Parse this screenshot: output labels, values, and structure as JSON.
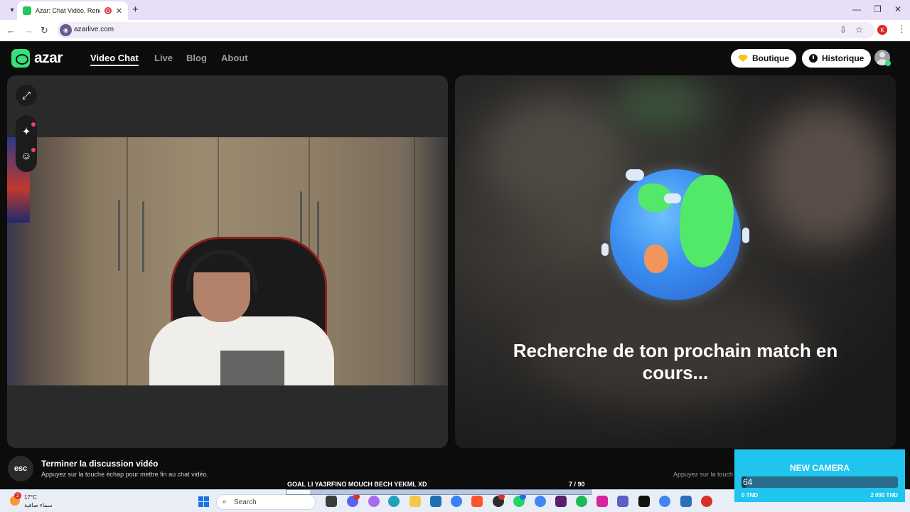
{
  "browser": {
    "tab_title": "Azar: Chat Vidéo, Rencontr",
    "url": "azarlive.com",
    "profile_initial": "K",
    "new_tab_symbol": "+",
    "close_symbol": "✕"
  },
  "header": {
    "logo_text": "azar",
    "nav": [
      "Video Chat",
      "Live",
      "Blog",
      "About"
    ],
    "active_nav": "Video Chat",
    "boutique_label": "Boutique",
    "historique_label": "Historique"
  },
  "matching": {
    "status_text": "Recherche de ton prochain match en cours..."
  },
  "escbar": {
    "key_label": "esc",
    "title": "Terminer la discussion vidéo",
    "subtitle": "Appuyez sur la touche échap pour mettre fin au chat vidéo.",
    "right_hint": "Appuyez sur la touch"
  },
  "overlay": {
    "goal_text": "GOAL LI YA3RFINO MOUCH BECH YEKML XD",
    "goal_counter": "7   / 90",
    "goal_progress": 0.078
  },
  "camera_goal": {
    "title": "NEW CAMERA",
    "value": "64",
    "min_label": "0 TND",
    "max_label": "2 000 TND",
    "progress": 0.032
  },
  "taskbar": {
    "weather_badge": "2",
    "weather_temp": "17°C",
    "weather_desc": "سماء صافية",
    "search_label": "Search"
  },
  "colors": {
    "accent_green": "#38e07b",
    "camera_box": "#20c5ee",
    "record_red": "#d9363e"
  }
}
